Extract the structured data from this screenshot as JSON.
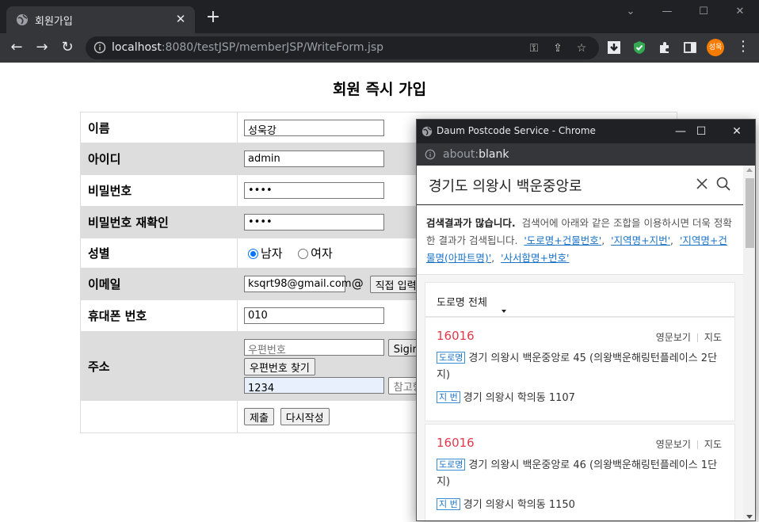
{
  "browser": {
    "tab_title": "회원가입",
    "tab_close": "✕",
    "new_tab": "+",
    "url_host": "localhost",
    "url_rest": ":8080/testJSP/memberJSP/WriteForm.jsp",
    "profile_label": "성욱",
    "window_controls": [
      "⌄",
      "—",
      "☐",
      "✕"
    ]
  },
  "page": {
    "title": "회원 즉시 가입",
    "form": {
      "name_label": "이름",
      "name_value": "성욱강",
      "id_label": "아이디",
      "id_value": "admin",
      "pw_label": "비밀번호",
      "pw_value": "••••",
      "pw2_label": "비밀번호 재확인",
      "pw2_value": "••••",
      "gender_label": "성별",
      "gender_male": "남자",
      "gender_female": "여자",
      "gender_selected": "남자",
      "email_label": "이메일",
      "email_value": "ksqrt98@gmail.com",
      "email_at": "@",
      "email_domain_btn": "직접 입력",
      "phone_label": "휴대폰 번호",
      "phone_value": "010",
      "address_label": "주소",
      "postcode_placeholder": "우편번호",
      "address_partial_btn": "Sigiri",
      "find_postcode_btn": "우편번호 찾기",
      "detail_value": "1234",
      "extra_partial": "참고항",
      "submit_btn": "제출",
      "reset_btn": "다시작성"
    }
  },
  "popup": {
    "window_title": "Daum Postcode Service - Chrome",
    "url_scheme": "about:",
    "url_page": "blank",
    "window_controls": [
      "—",
      "☐",
      "✕"
    ],
    "search_query": "경기도 의왕시 백운중앙로",
    "notice_bold": "검색결과가 많습니다.",
    "notice_text": "검색어에 아래와 같은 조합을 이용하시면 더욱 정확한 결과가 검색됩니다.",
    "hint_links": [
      "'도로명+건물번호'",
      "'지역명+지번'",
      "'지역명+건물명(아파트명)'",
      "'사서함명+번호'"
    ],
    "filter_label": "도로명 전체",
    "results": [
      {
        "zip": "16016",
        "english_link": "영문보기",
        "map_link": "지도",
        "road_tag": "도로명",
        "road_address": "경기 의왕시 백운중앙로 45 (의왕백운해링턴플레이스 2단지)",
        "jibun_tag": "지 번",
        "jibun_address": "경기 의왕시 학의동 1107"
      },
      {
        "zip": "16016",
        "english_link": "영문보기",
        "map_link": "지도",
        "road_tag": "도로명",
        "road_address": "경기 의왕시 백운중앙로 46 (의왕백운해링턴플레이스 1단지)",
        "jibun_tag": "지 번",
        "jibun_address": "경기 의왕시 학의동 1150"
      }
    ]
  }
}
